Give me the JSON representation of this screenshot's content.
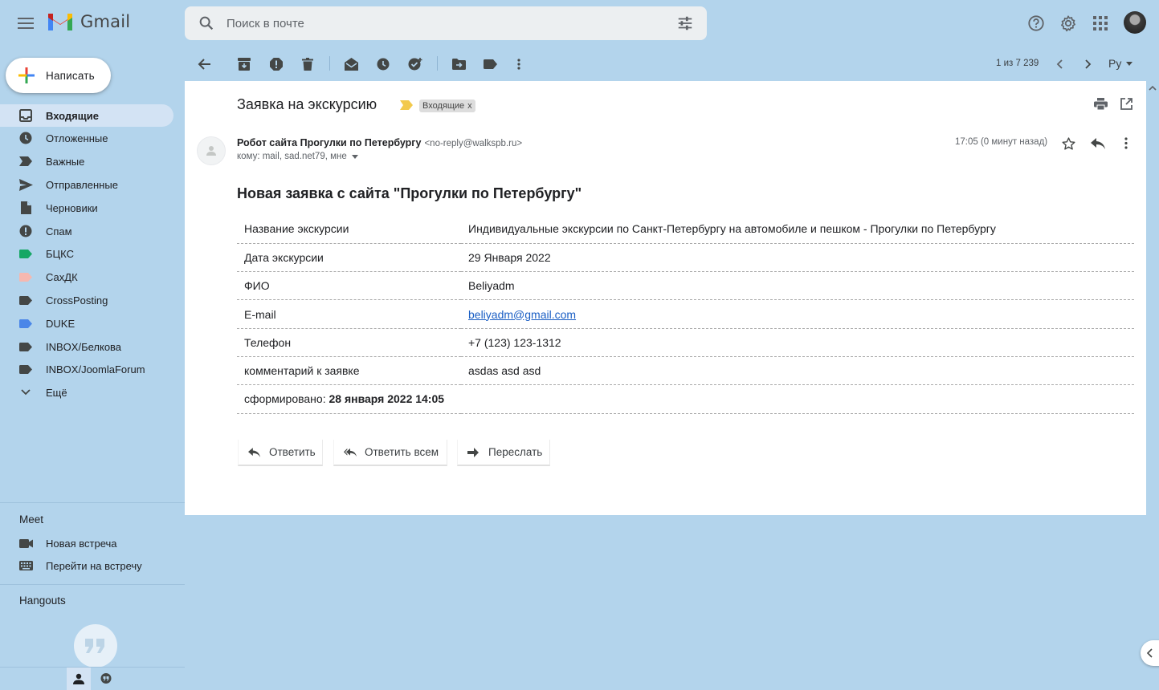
{
  "app": {
    "name": "Gmail"
  },
  "search": {
    "placeholder": "Поиск в почте"
  },
  "compose": {
    "label": "Написать"
  },
  "nav": [
    {
      "label": "Входящие",
      "icon": "inbox-icon",
      "active": true
    },
    {
      "label": "Отложенные",
      "icon": "clock-icon"
    },
    {
      "label": "Важные",
      "icon": "important-icon"
    },
    {
      "label": "Отправленные",
      "icon": "send-icon"
    },
    {
      "label": "Черновики",
      "icon": "draft-icon"
    },
    {
      "label": "Спам",
      "icon": "spam-icon"
    },
    {
      "label": "БЦКС",
      "icon": "label-icon",
      "color": "#16a765"
    },
    {
      "label": "СахДК",
      "icon": "label-icon",
      "color": "#f6b8b0"
    },
    {
      "label": "CrossPosting",
      "icon": "label-icon",
      "color": "#444746"
    },
    {
      "label": "DUKE",
      "icon": "label-icon",
      "color": "#4a86e8"
    },
    {
      "label": "INBOX/Белкова",
      "icon": "label-icon",
      "color": "#444746"
    },
    {
      "label": "INBOX/JoomlaForum",
      "icon": "label-icon",
      "color": "#444746"
    },
    {
      "label": "Ещё",
      "icon": "chevron-down-icon"
    }
  ],
  "meet": {
    "title": "Meet",
    "items": [
      {
        "label": "Новая встреча",
        "icon": "video-icon"
      },
      {
        "label": "Перейти на встречу",
        "icon": "keyboard-icon"
      }
    ]
  },
  "hangouts": {
    "title": "Hangouts"
  },
  "toolbar": {
    "counter": "1 из 7 239",
    "lang": "Ру"
  },
  "email": {
    "subject": "Заявка на экскурсию",
    "tag": "Входящие",
    "tag_close": "x",
    "sender_name": "Робот сайта Прогулки по Петербургу",
    "sender_email": "<no-reply@walkspb.ru>",
    "recipients": "кому: mail, sad.net79, мне",
    "time": "17:05 (0 минут назад)",
    "heading": "Новая заявка с сайта \"Прогулки по Петербургу\"",
    "rows": [
      {
        "key": "Название экскурсии",
        "value": "Индивидуальные экскурсии по Санкт-Петербургу на автомобиле и пешком - Прогулки по Петербургу"
      },
      {
        "key": "Дата экскурсии",
        "value": "29 Января 2022"
      },
      {
        "key": "ФИО",
        "value": "Beliyadm"
      },
      {
        "key": "E-mail",
        "value": "beliyadm@gmail.com"
      },
      {
        "key": "Телефон",
        "value": "+7 (123) 123-1312"
      },
      {
        "key": "комментарий к заявке",
        "value": "asdas asd asd"
      }
    ],
    "formed_label": "сформировано:",
    "formed_value": "28 января 2022 14:05"
  },
  "actions": {
    "reply": "Ответить",
    "reply_all": "Ответить всем",
    "forward": "Переслать"
  }
}
